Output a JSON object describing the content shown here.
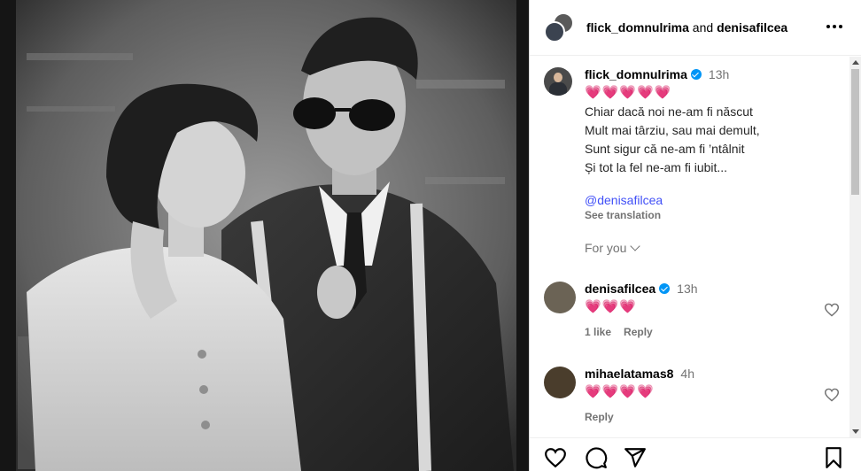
{
  "header": {
    "user1": "flick_domnulrima",
    "connector": " and ",
    "user2": "denisafilcea"
  },
  "post": {
    "username": "flick_domnulrima",
    "time": "13h",
    "hearts": "💗💗💗💗💗",
    "caption_lines": [
      "Chiar dacă noi ne-am fi născut",
      "Mult mai târziu, sau mai demult,",
      "Sunt sigur că ne-am fi ’ntâlnit",
      "Și tot la fel ne-am fi iubit..."
    ],
    "mention": "@denisafilcea",
    "see_translation": "See translation",
    "for_you": "For you"
  },
  "comments": [
    {
      "username": "denisafilcea",
      "time": "13h",
      "hearts": "💗💗💗",
      "likes": "1 like",
      "reply": "Reply"
    },
    {
      "username": "mihaelatamas8",
      "time": "4h",
      "hearts": "💗💗💗💗",
      "reply": "Reply"
    }
  ],
  "colors": {
    "accent": "#0095f6",
    "mention": "#4150f7",
    "heart": "#ed4956"
  }
}
